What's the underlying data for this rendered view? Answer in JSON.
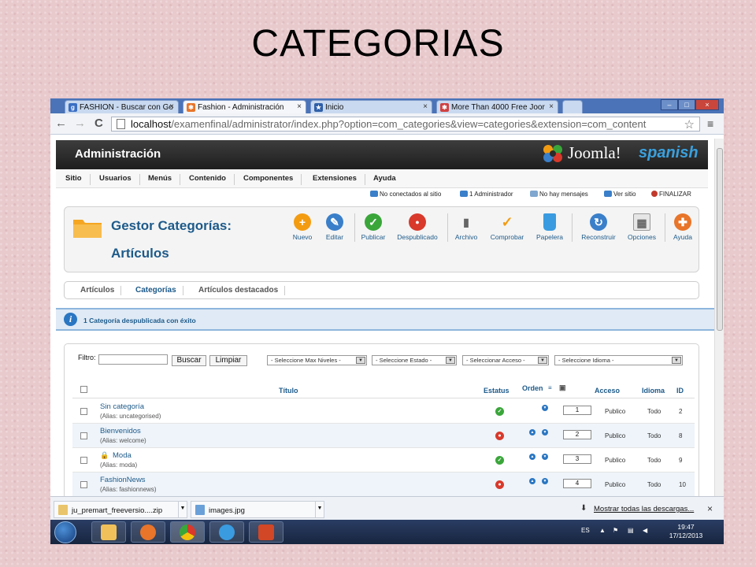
{
  "slide_title": "CATEGORIAS",
  "tabs": [
    {
      "label": "FASHION - Buscar con Go",
      "icon": "google-icon",
      "color": "#3b6fc4",
      "close": "×"
    },
    {
      "label": "Fashion - Administración",
      "icon": "joomla-icon",
      "color": "#e8752a",
      "close": "×"
    },
    {
      "label": "Inicio",
      "icon": "star-icon",
      "color": "#2f5fa8",
      "close": "×"
    },
    {
      "label": "More Than 4000 Free Joor",
      "icon": "joomla-icon",
      "color": "#d04040",
      "close": "×"
    }
  ],
  "window_controls": [
    "–",
    "□",
    "×"
  ],
  "address": {
    "host": "localhost",
    "path": "/examenfinal/administrator/index.php?option=com_categories&view=categories&extension=com_content",
    "back": "←",
    "forward": "→",
    "reload": "C",
    "star": "☆",
    "menu": "≡"
  },
  "admin": {
    "title": "Administración",
    "brand": "Joomla!",
    "brand_suffix": "spanish"
  },
  "menu": [
    "Sitio",
    "Usuarios",
    "Menús",
    "Contenido",
    "Componentes",
    "Extensiones",
    "Ayuda"
  ],
  "status": [
    {
      "label": "No conectados al sitio",
      "color": "#3a7fc9"
    },
    {
      "label": "1 Administrador",
      "color": "#3a7fc9"
    },
    {
      "label": "No hay mensajes",
      "color": "#7fa7cf"
    },
    {
      "label": "Ver sitio",
      "color": "#3a7fc9"
    },
    {
      "label": "FINALIZAR",
      "color": "#c0392b"
    }
  ],
  "manager": {
    "title": "Gestor Categorías:",
    "subtitle": "Artículos"
  },
  "toolbar": [
    {
      "label": "Nuevo",
      "icon": "add-icon",
      "color": "#f39c12",
      "glyph": "+"
    },
    {
      "label": "Editar",
      "icon": "edit-icon",
      "color": "#3a7fc9",
      "glyph": "✎"
    },
    {
      "label": "Publicar",
      "icon": "publish-icon",
      "color": "#3aa63a",
      "glyph": "✓"
    },
    {
      "label": "Despublicado",
      "icon": "unpublish-icon",
      "color": "#d8392b",
      "glyph": "●"
    },
    {
      "label": "Archivo",
      "icon": "archive-icon",
      "color": "#8a8a8a",
      "glyph": "▮"
    },
    {
      "label": "Comprobar",
      "icon": "checkin-icon",
      "color": "#f39c12",
      "glyph": "✓"
    },
    {
      "label": "Papelera",
      "icon": "trash-icon",
      "color": "#3a9be0",
      "glyph": "🗑"
    },
    {
      "label": "Reconstruir",
      "icon": "rebuild-icon",
      "color": "#3a7fc9",
      "glyph": "↻"
    },
    {
      "label": "Opciones",
      "icon": "options-icon",
      "color": "#9a9a9a",
      "glyph": "▦"
    },
    {
      "label": "Ayuda",
      "icon": "help-icon",
      "color": "#e8752a",
      "glyph": "✚"
    }
  ],
  "subnav": [
    "Artículos",
    "Categorías",
    "Artículos destacados"
  ],
  "message": "1 Categoría despublicada con éxito",
  "filter": {
    "label": "Filtro:",
    "value": "",
    "search_button": "Buscar",
    "clear_button": "Limpiar"
  },
  "selects": [
    "- Seleccione Max Niveles -",
    "- Seleccione Estado -",
    "- Seleccionar Acceso -",
    "- Seleccione Idioma -"
  ],
  "columns": {
    "title": "Título",
    "status": "Estatus",
    "order": "Orden",
    "access": "Acceso",
    "language": "Idioma",
    "id": "ID"
  },
  "rows": [
    {
      "title": "Sin categoría",
      "alias": "(Alias: uncategorised)",
      "published": true,
      "order": "1",
      "access": "Publico",
      "language": "Todo",
      "id": "2"
    },
    {
      "title": "Bienvenidos",
      "alias": "(Alias: welcome)",
      "published": false,
      "order": "2",
      "access": "Publico",
      "language": "Todo",
      "id": "8"
    },
    {
      "title": "Moda",
      "alias": "(Alias: moda)",
      "published": true,
      "order": "3",
      "access": "Publico",
      "language": "Todo",
      "id": "9",
      "locked": true
    },
    {
      "title": "FashionNews",
      "alias": "(Alias: fashionnews)",
      "published": false,
      "order": "4",
      "access": "Publico",
      "language": "Todo",
      "id": "10"
    }
  ],
  "downloads": {
    "items": [
      "ju_premart_freeversio....zip",
      "images.jpg"
    ],
    "show_all": "Mostrar todas las descargas...",
    "close": "×"
  },
  "taskbar": {
    "lang": "ES",
    "time": "19:47",
    "date": "17/12/2013"
  }
}
